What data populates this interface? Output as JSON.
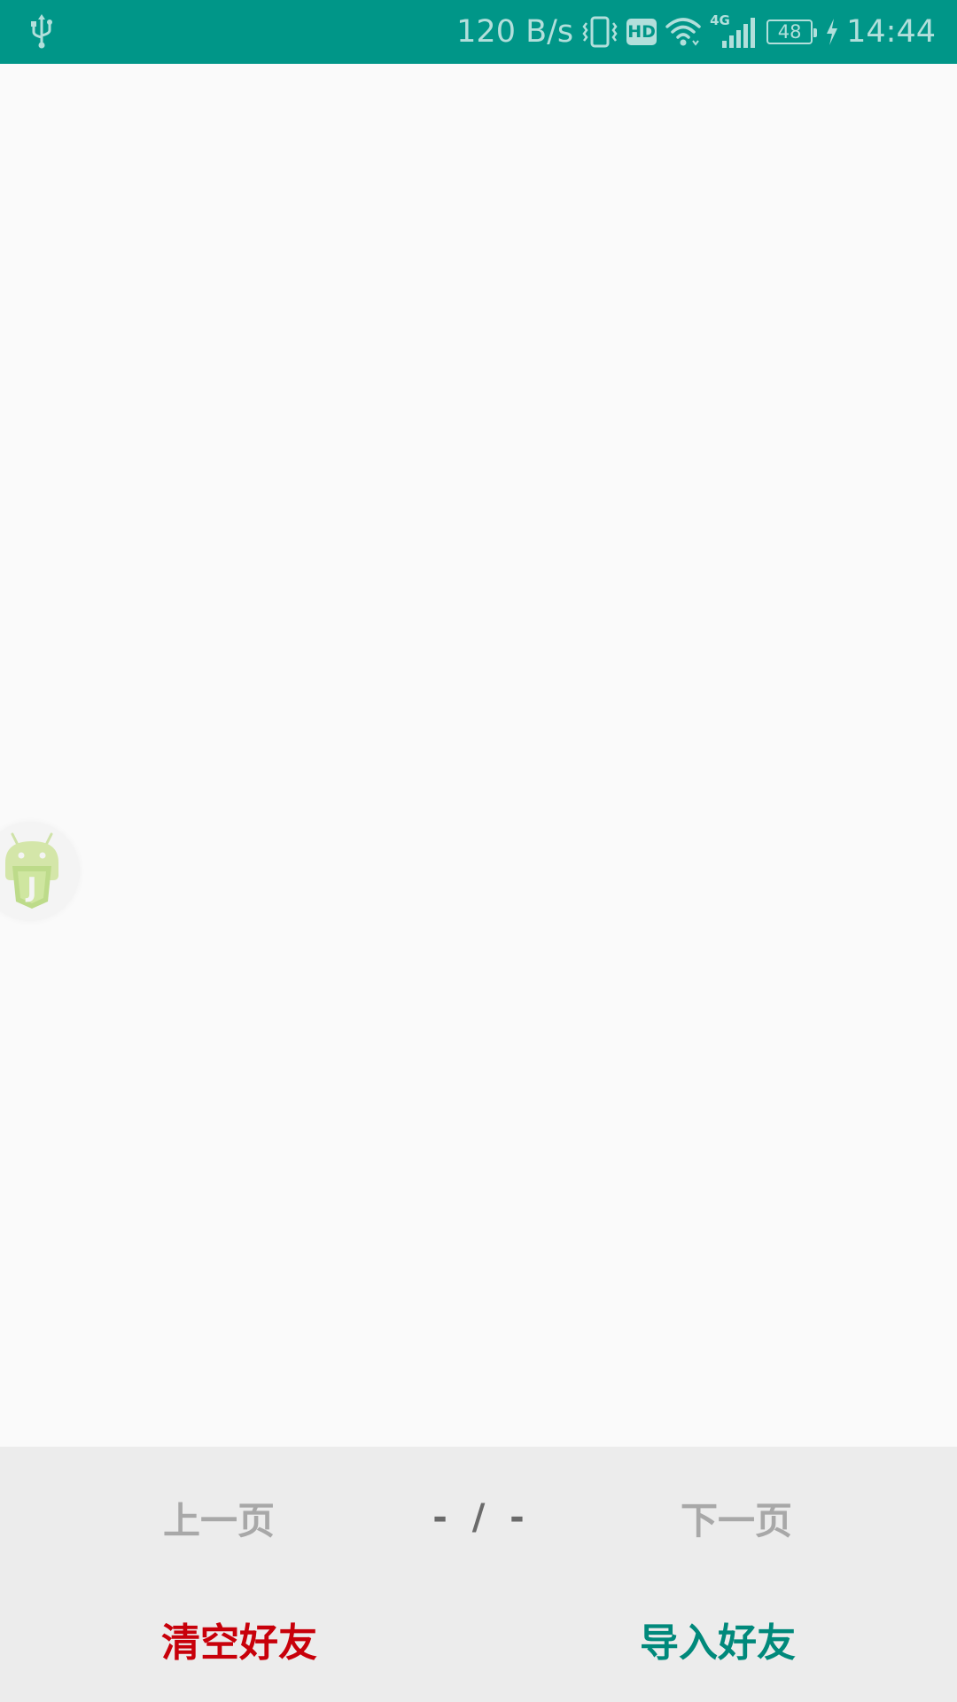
{
  "status_bar": {
    "network_speed": "120 B/s",
    "network_type": "4G",
    "hd_badge": "HD",
    "battery_level": "48",
    "time": "14:44",
    "icons": [
      "usb-icon",
      "vibrate-icon",
      "hd-icon",
      "wifi-icon",
      "signal-icon",
      "battery-icon",
      "charging-icon"
    ]
  },
  "floating_badge": {
    "icon": "android-js-icon",
    "letter": "J"
  },
  "bottom_panel": {
    "prev_label": "上一页",
    "page_indicator": "-  /  -",
    "next_label": "下一页",
    "clear_friends_label": "清空好友",
    "import_friends_label": "导入好友"
  },
  "colors": {
    "status_bar_bg": "#009688",
    "status_text": "#b2dfdb",
    "clear_button": "#c8000a",
    "import_button": "#00897b",
    "pager_disabled": "#a8a8a8",
    "panel_bg": "#ececec"
  }
}
